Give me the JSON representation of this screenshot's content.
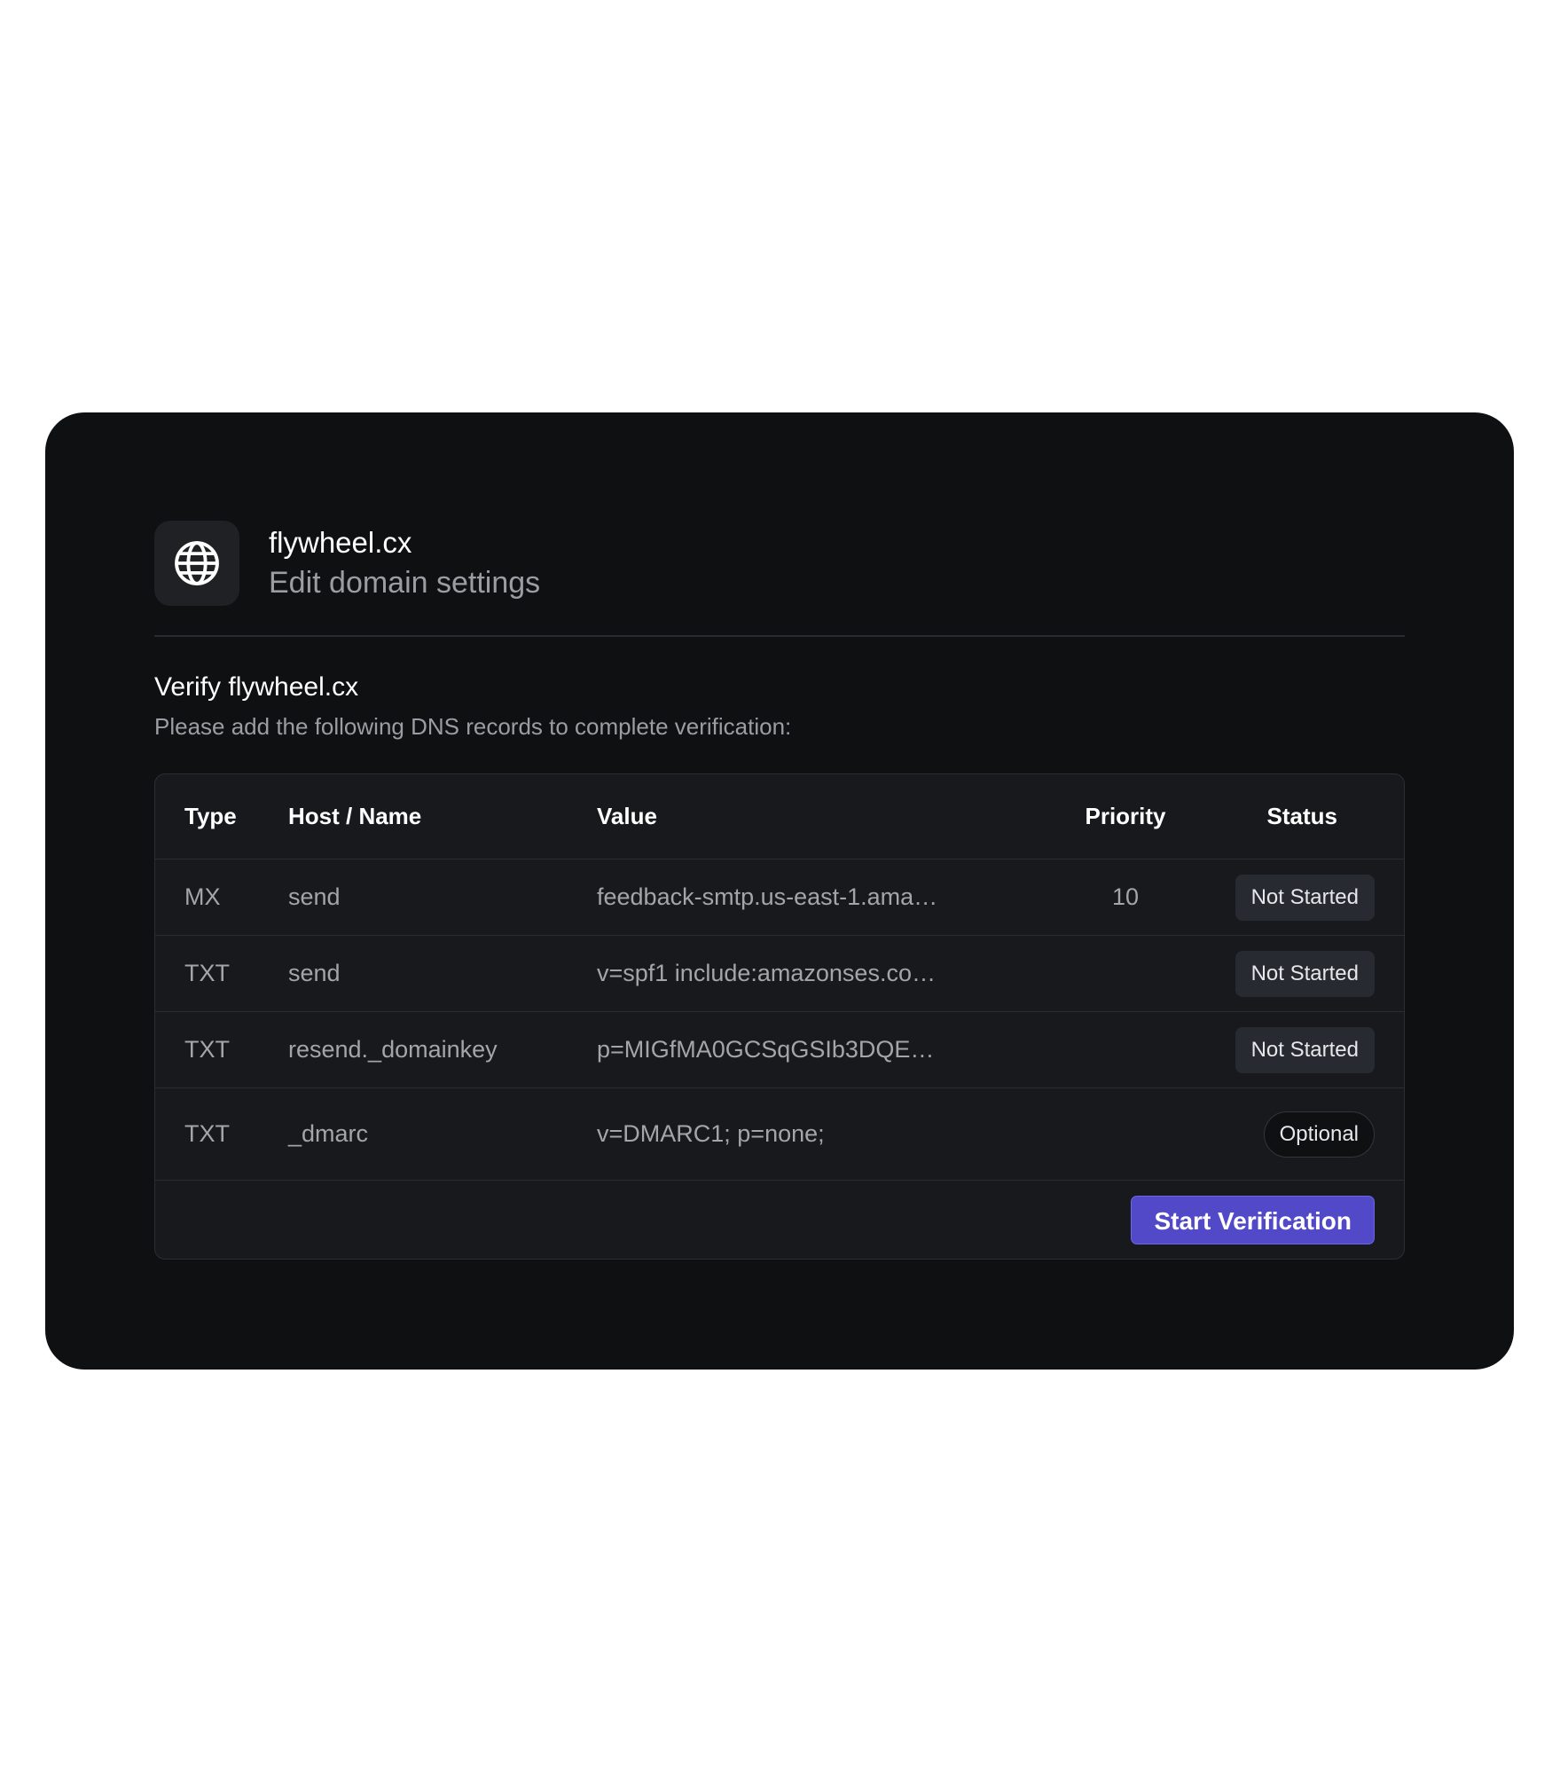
{
  "header": {
    "domain": "flywheel.cx",
    "subtitle": "Edit domain settings",
    "icon": "globe-icon"
  },
  "verify": {
    "title": "Verify flywheel.cx",
    "description": "Please add the following DNS records to complete verification:"
  },
  "table": {
    "columns": {
      "type": "Type",
      "host": "Host / Name",
      "value": "Value",
      "priority": "Priority",
      "status": "Status"
    },
    "rows": [
      {
        "type": "MX",
        "host": "send",
        "value": "feedback-smtp.us-east-1.ama…",
        "priority": "10",
        "status": "Not Started"
      },
      {
        "type": "TXT",
        "host": "send",
        "value": "v=spf1 include:amazonses.co…",
        "priority": "",
        "status": "Not Started"
      },
      {
        "type": "TXT",
        "host": "resend._domainkey",
        "value": "p=MIGfMA0GCSqGSIb3DQE…",
        "priority": "",
        "status": "Not Started"
      },
      {
        "type": "TXT",
        "host": "_dmarc",
        "value": "v=DMARC1; p=none;",
        "priority": "",
        "status": "Optional"
      }
    ]
  },
  "actions": {
    "start_verification": "Start Verification"
  },
  "colors": {
    "card_bg": "#0f1012",
    "table_bg": "#18191c",
    "accent": "#5249c9"
  }
}
